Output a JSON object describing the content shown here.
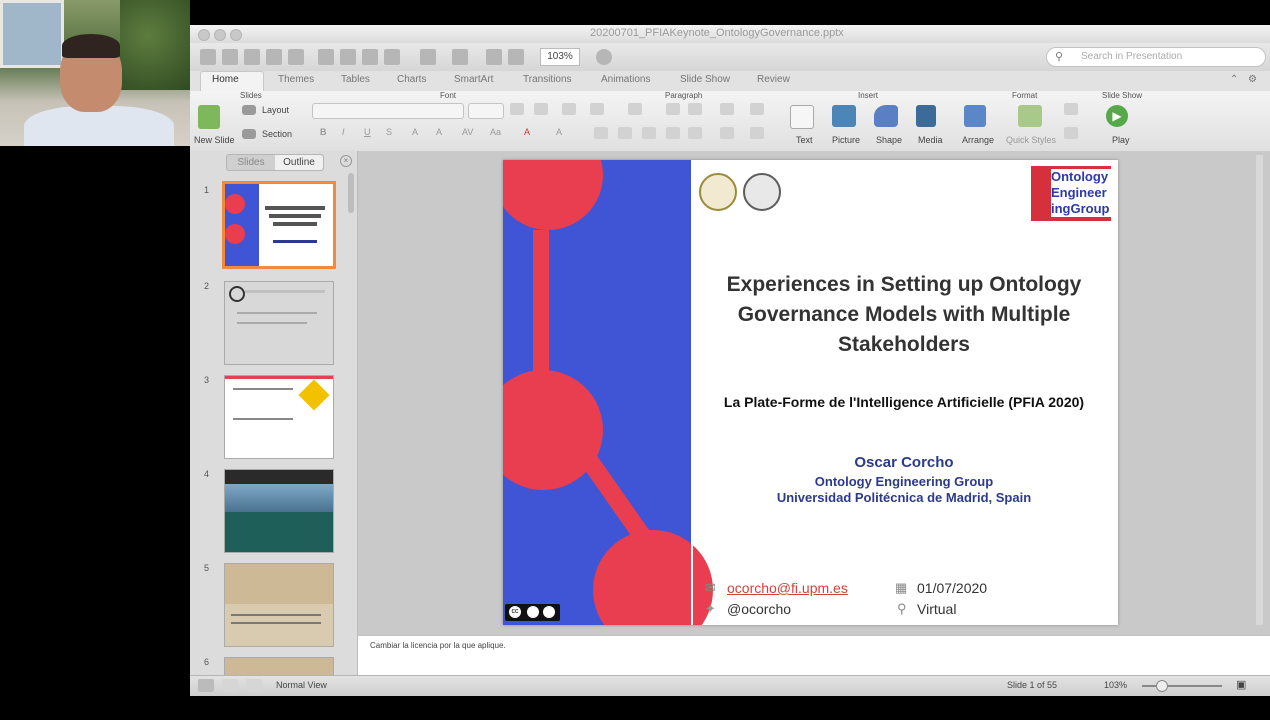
{
  "window": {
    "title": "20200701_PFIAKeynote_OntologyGovernance.pptx"
  },
  "toolbar": {
    "zoom_value": "103%",
    "search_placeholder": "Search in Presentation"
  },
  "tabs": [
    "Home",
    "Themes",
    "Tables",
    "Charts",
    "SmartArt",
    "Transitions",
    "Animations",
    "Slide Show",
    "Review"
  ],
  "ribbon": {
    "groups": {
      "slides": "Slides",
      "font": "Font",
      "paragraph": "Paragraph",
      "insert": "Insert",
      "format": "Format",
      "slide_show": "Slide Show"
    },
    "new_slide": "New Slide",
    "layout": "Layout",
    "section": "Section",
    "text": "Text",
    "picture": "Picture",
    "shape": "Shape",
    "media": "Media",
    "arrange": "Arrange",
    "quick_styles": "Quick Styles",
    "play": "Play"
  },
  "leftpanel": {
    "seg_slides": "Slides",
    "seg_outline": "Outline",
    "thumb_numbers": [
      "1",
      "2",
      "3",
      "4",
      "5",
      "6"
    ]
  },
  "slide": {
    "title": "Experiences in Setting up Ontology Governance Models with Multiple Stakeholders",
    "subtitle": "La Plate-Forme de l'Intelligence Artificielle (PFIA 2020)",
    "author": "Oscar Corcho",
    "group": "Ontology Engineering Group",
    "university": "Universidad Politécnica de Madrid, Spain",
    "email": "ocorcho@fi.upm.es",
    "twitter": "@ocorcho",
    "date": "01/07/2020",
    "location": "Virtual",
    "logo_text": "Ontology Engineer ingGroup"
  },
  "notes": "Cambiar la licencia por la que aplique.",
  "status": {
    "view": "Normal View",
    "slide_counter": "Slide 1 of 55",
    "zoom": "103%"
  },
  "colors": {
    "accent_red": "#e83e4f",
    "accent_blue": "#3f55d6",
    "text_blue": "#2c3a8c",
    "thumb_select": "#f08a3c"
  },
  "icons": [
    "mail-icon",
    "twitter-icon",
    "calendar-icon",
    "location-pin-icon",
    "search-icon",
    "play-icon"
  ]
}
